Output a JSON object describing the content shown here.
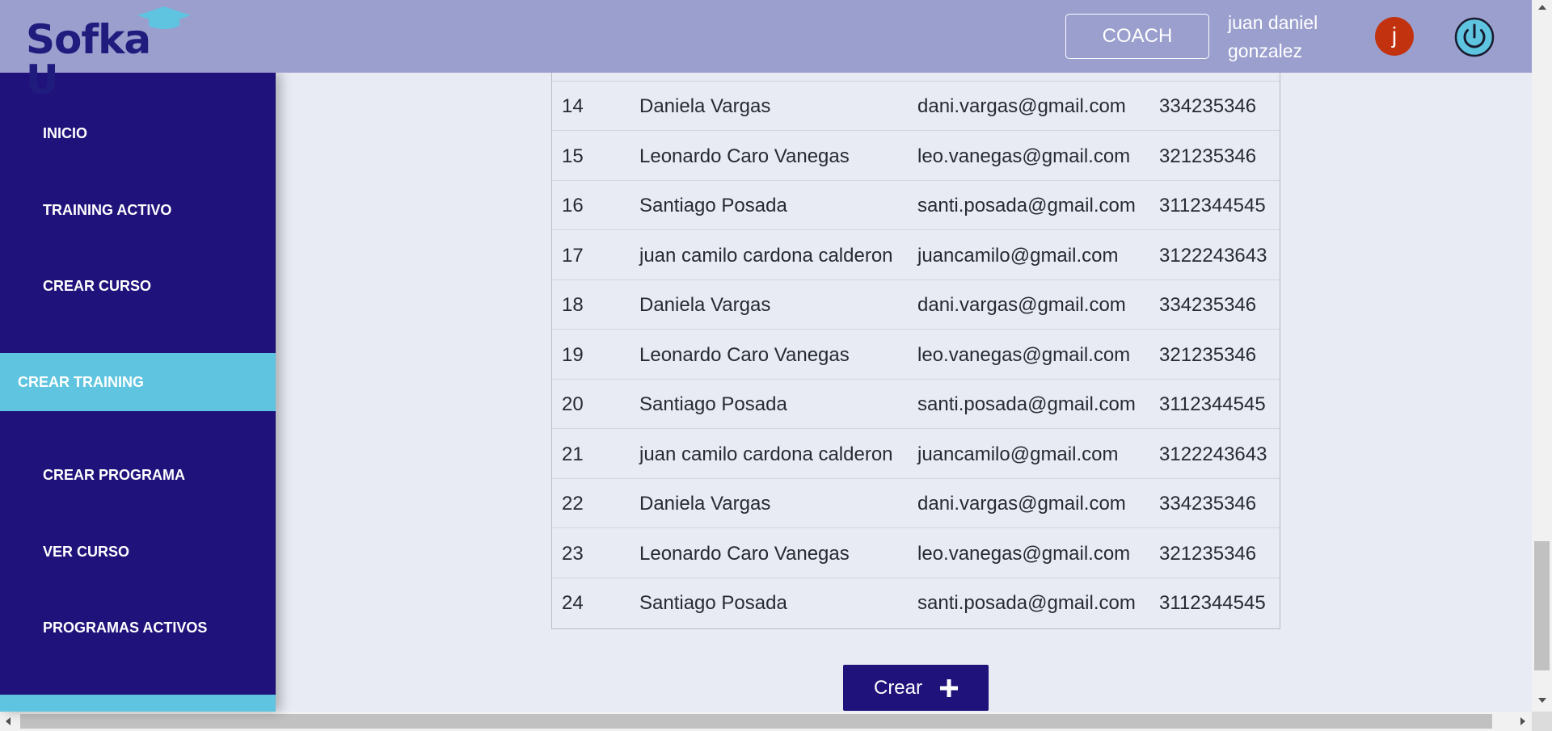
{
  "header": {
    "logo_text": "Sofka U",
    "role_label": "COACH",
    "user_name": "juan daniel gonzalez",
    "avatar_initial": "j"
  },
  "sidebar": {
    "items": [
      {
        "label": "INICIO"
      },
      {
        "label": "TRAINING ACTIVO"
      },
      {
        "label": "CREAR CURSO"
      },
      {
        "label": "CREAR TRAINING",
        "active": true
      },
      {
        "label": "CREAR PROGRAMA"
      },
      {
        "label": "VER CURSO"
      },
      {
        "label": "PROGRAMAS ACTIVOS"
      }
    ]
  },
  "table": {
    "rows": [
      {
        "num": "14",
        "name": "Daniela Vargas",
        "email": "dani.vargas@gmail.com",
        "phone": "334235346"
      },
      {
        "num": "15",
        "name": "Leonardo Caro Vanegas",
        "email": "leo.vanegas@gmail.com",
        "phone": "321235346"
      },
      {
        "num": "16",
        "name": "Santiago Posada",
        "email": "santi.posada@gmail.com",
        "phone": "3112344545"
      },
      {
        "num": "17",
        "name": "juan camilo cardona calderon",
        "email": "juancamilo@gmail.com",
        "phone": "3122243643"
      },
      {
        "num": "18",
        "name": "Daniela Vargas",
        "email": "dani.vargas@gmail.com",
        "phone": "334235346"
      },
      {
        "num": "19",
        "name": "Leonardo Caro Vanegas",
        "email": "leo.vanegas@gmail.com",
        "phone": "321235346"
      },
      {
        "num": "20",
        "name": "Santiago Posada",
        "email": "santi.posada@gmail.com",
        "phone": "3112344545"
      },
      {
        "num": "21",
        "name": "juan camilo cardona calderon",
        "email": "juancamilo@gmail.com",
        "phone": "3122243643"
      },
      {
        "num": "22",
        "name": "Daniela Vargas",
        "email": "dani.vargas@gmail.com",
        "phone": "334235346"
      },
      {
        "num": "23",
        "name": "Leonardo Caro Vanegas",
        "email": "leo.vanegas@gmail.com",
        "phone": "321235346"
      },
      {
        "num": "24",
        "name": "Santiago Posada",
        "email": "santi.posada@gmail.com",
        "phone": "3112344545"
      }
    ]
  },
  "actions": {
    "create_label": "Crear"
  },
  "colors": {
    "header_bg": "#9a9fcd",
    "sidebar_bg": "#20127b",
    "sidebar_active": "#5ec4df",
    "page_bg": "#e8ebf4",
    "avatar_bg": "#c3320f",
    "power_icon": "#5ec4df"
  }
}
